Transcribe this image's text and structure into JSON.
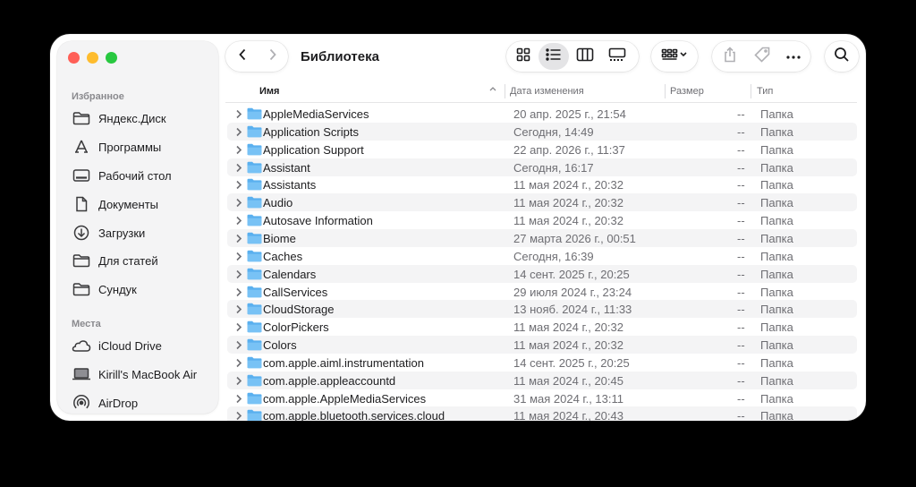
{
  "window": {
    "title": "Библиотека"
  },
  "sidebar": {
    "favorites_title": "Избранное",
    "favorites": [
      {
        "label": "Яндекс.Диск",
        "icon": "folder-icon"
      },
      {
        "label": "Программы",
        "icon": "applications-icon"
      },
      {
        "label": "Рабочий стол",
        "icon": "desktop-icon"
      },
      {
        "label": "Документы",
        "icon": "document-icon"
      },
      {
        "label": "Загрузки",
        "icon": "download-icon"
      },
      {
        "label": "Для статей",
        "icon": "folder-icon"
      },
      {
        "label": "Сундук",
        "icon": "folder-icon"
      }
    ],
    "places_title": "Места",
    "places": [
      {
        "label": "iCloud Drive",
        "icon": "cloud-icon"
      },
      {
        "label": "Kirill's MacBook Air",
        "icon": "laptop-icon"
      },
      {
        "label": "AirDrop",
        "icon": "airdrop-icon"
      }
    ]
  },
  "columns": {
    "name": "Имя",
    "date": "Дата изменения",
    "size": "Размер",
    "kind": "Тип"
  },
  "rows": [
    {
      "name": "AppleMediaServices",
      "date": "20 апр. 2025 г., 21:54",
      "size": "--",
      "kind": "Папка"
    },
    {
      "name": "Application Scripts",
      "date": "Сегодня, 14:49",
      "size": "--",
      "kind": "Папка"
    },
    {
      "name": "Application Support",
      "date": "22 апр. 2026 г., 11:37",
      "size": "--",
      "kind": "Папка"
    },
    {
      "name": "Assistant",
      "date": "Сегодня, 16:17",
      "size": "--",
      "kind": "Папка"
    },
    {
      "name": "Assistants",
      "date": "11 мая 2024 г., 20:32",
      "size": "--",
      "kind": "Папка"
    },
    {
      "name": "Audio",
      "date": "11 мая 2024 г., 20:32",
      "size": "--",
      "kind": "Папка"
    },
    {
      "name": "Autosave Information",
      "date": "11 мая 2024 г., 20:32",
      "size": "--",
      "kind": "Папка"
    },
    {
      "name": "Biome",
      "date": "27 марта 2026 г., 00:51",
      "size": "--",
      "kind": "Папка"
    },
    {
      "name": "Caches",
      "date": "Сегодня, 16:39",
      "size": "--",
      "kind": "Папка"
    },
    {
      "name": "Calendars",
      "date": "14 сент. 2025 г., 20:25",
      "size": "--",
      "kind": "Папка"
    },
    {
      "name": "CallServices",
      "date": "29 июля 2024 г., 23:24",
      "size": "--",
      "kind": "Папка"
    },
    {
      "name": "CloudStorage",
      "date": "13 нояб. 2024 г., 11:33",
      "size": "--",
      "kind": "Папка"
    },
    {
      "name": "ColorPickers",
      "date": "11 мая 2024 г., 20:32",
      "size": "--",
      "kind": "Папка"
    },
    {
      "name": "Colors",
      "date": "11 мая 2024 г., 20:32",
      "size": "--",
      "kind": "Папка"
    },
    {
      "name": "com.apple.aiml.instrumentation",
      "date": "14 сент. 2025 г., 20:25",
      "size": "--",
      "kind": "Папка"
    },
    {
      "name": "com.apple.appleaccountd",
      "date": "11 мая 2024 г., 20:45",
      "size": "--",
      "kind": "Папка"
    },
    {
      "name": "com.apple.AppleMediaServices",
      "date": "31 мая 2024 г., 13:11",
      "size": "--",
      "kind": "Папка"
    },
    {
      "name": "com.apple.bluetooth.services.cloud",
      "date": "11 мая 2024 г., 20:43",
      "size": "--",
      "kind": "Папка"
    }
  ],
  "colors": {
    "folder": "#5ab0ef",
    "close": "#ff5f57",
    "minimize": "#febc2e",
    "zoom": "#28c840"
  }
}
